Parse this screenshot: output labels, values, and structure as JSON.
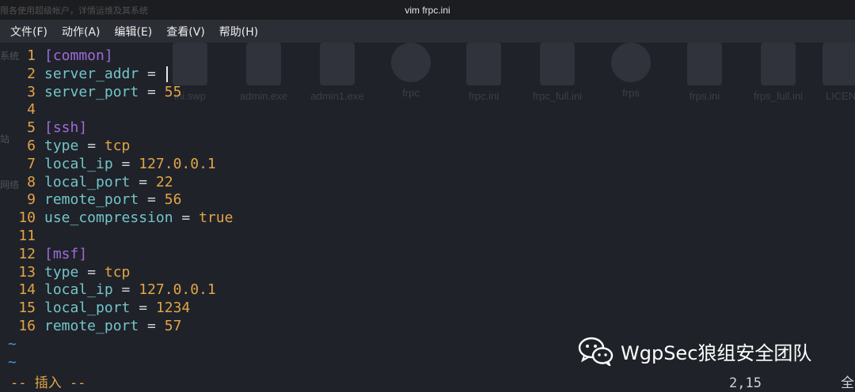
{
  "window": {
    "title": "vim frpc.ini",
    "background_text": "限各使用超级帐户，详情运维及其系统"
  },
  "menu": [
    "文件(F)",
    "动作(A)",
    "编辑(E)",
    "查看(V)",
    "帮助(H)"
  ],
  "background_files": [
    "ini.swp",
    "admin.exe",
    "admin1.exe",
    "frpc",
    "frpc.ini",
    "frpc_full.ini",
    "frps",
    "frps.ini",
    "frps_full.ini",
    "LICEN"
  ],
  "background_side": [
    "系统",
    "站",
    "网络"
  ],
  "editor": {
    "lines": [
      {
        "n": "1",
        "section": "[common]"
      },
      {
        "n": "2",
        "key": "server_addr",
        "eq": " = ",
        "val": "",
        "cursor": true
      },
      {
        "n": "3",
        "key": "server_port",
        "eq": " = ",
        "val": "55"
      },
      {
        "n": "4"
      },
      {
        "n": "5",
        "section": "[ssh]"
      },
      {
        "n": "6",
        "key": "type",
        "eq": " = ",
        "val": "tcp"
      },
      {
        "n": "7",
        "key": "local_ip",
        "eq": " = ",
        "val": "127.0.0.1"
      },
      {
        "n": "8",
        "key": "local_port",
        "eq": " = ",
        "val": "22"
      },
      {
        "n": "9",
        "key": "remote_port",
        "eq": " = ",
        "val": "56"
      },
      {
        "n": "10",
        "key": "use_compression",
        "eq": " = ",
        "val": "true"
      },
      {
        "n": "11"
      },
      {
        "n": "12",
        "section": "[msf]"
      },
      {
        "n": "13",
        "key": "type",
        "eq": " = ",
        "val": "tcp"
      },
      {
        "n": "14",
        "key": "local_ip",
        "eq": " = ",
        "val": "127.0.0.1"
      },
      {
        "n": "15",
        "key": "local_port",
        "eq": " = ",
        "val": "1234"
      },
      {
        "n": "16",
        "key": "remote_port",
        "eq": " = ",
        "val": "57"
      }
    ],
    "tildes": [
      "~",
      "~"
    ]
  },
  "status": {
    "mode": "-- 插入 --",
    "position": "2,15",
    "scroll": "全"
  },
  "watermark": {
    "text": "WgpSec狼组安全团队"
  },
  "colors": {
    "background": "#1f2229",
    "line_number": "#e2a447",
    "section": "#9e6bd9",
    "key": "#73c5c8",
    "value": "#e2a447",
    "tilde": "#4c8fd6"
  }
}
